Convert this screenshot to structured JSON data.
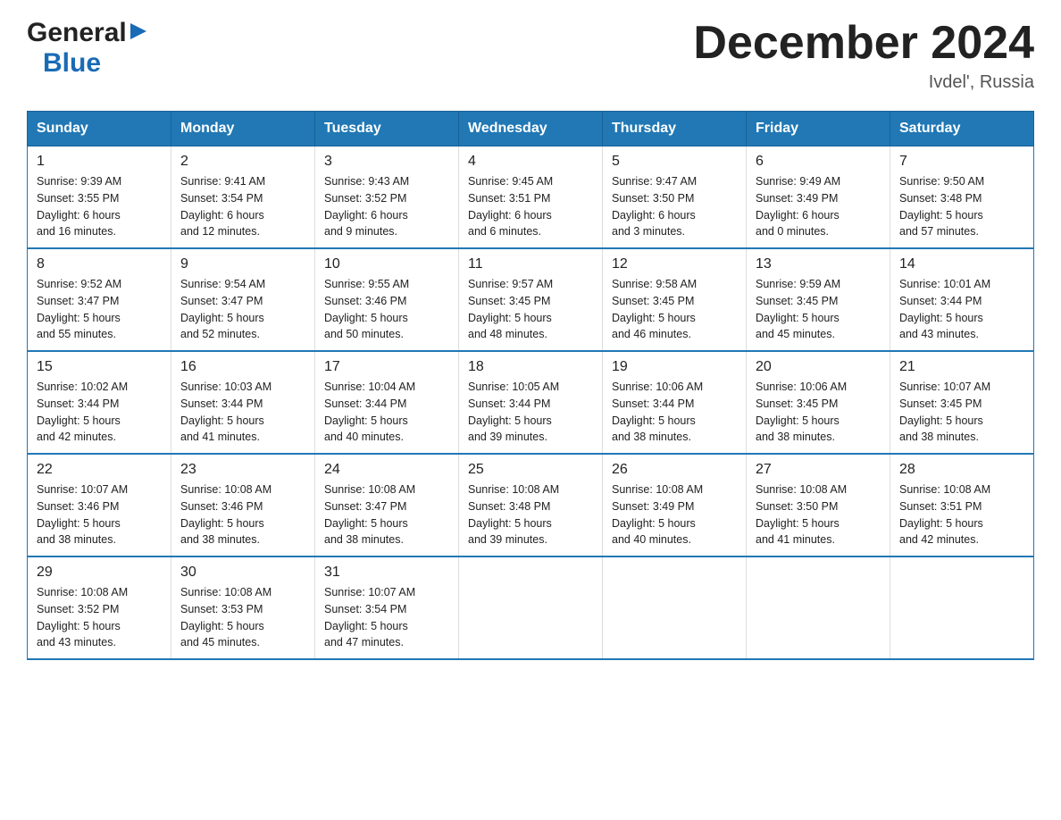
{
  "logo": {
    "general": "General",
    "arrow": "▶",
    "blue": "Blue"
  },
  "title": "December 2024",
  "location": "Ivdel', Russia",
  "headers": [
    "Sunday",
    "Monday",
    "Tuesday",
    "Wednesday",
    "Thursday",
    "Friday",
    "Saturday"
  ],
  "weeks": [
    [
      {
        "day": "1",
        "info": "Sunrise: 9:39 AM\nSunset: 3:55 PM\nDaylight: 6 hours\nand 16 minutes."
      },
      {
        "day": "2",
        "info": "Sunrise: 9:41 AM\nSunset: 3:54 PM\nDaylight: 6 hours\nand 12 minutes."
      },
      {
        "day": "3",
        "info": "Sunrise: 9:43 AM\nSunset: 3:52 PM\nDaylight: 6 hours\nand 9 minutes."
      },
      {
        "day": "4",
        "info": "Sunrise: 9:45 AM\nSunset: 3:51 PM\nDaylight: 6 hours\nand 6 minutes."
      },
      {
        "day": "5",
        "info": "Sunrise: 9:47 AM\nSunset: 3:50 PM\nDaylight: 6 hours\nand 3 minutes."
      },
      {
        "day": "6",
        "info": "Sunrise: 9:49 AM\nSunset: 3:49 PM\nDaylight: 6 hours\nand 0 minutes."
      },
      {
        "day": "7",
        "info": "Sunrise: 9:50 AM\nSunset: 3:48 PM\nDaylight: 5 hours\nand 57 minutes."
      }
    ],
    [
      {
        "day": "8",
        "info": "Sunrise: 9:52 AM\nSunset: 3:47 PM\nDaylight: 5 hours\nand 55 minutes."
      },
      {
        "day": "9",
        "info": "Sunrise: 9:54 AM\nSunset: 3:47 PM\nDaylight: 5 hours\nand 52 minutes."
      },
      {
        "day": "10",
        "info": "Sunrise: 9:55 AM\nSunset: 3:46 PM\nDaylight: 5 hours\nand 50 minutes."
      },
      {
        "day": "11",
        "info": "Sunrise: 9:57 AM\nSunset: 3:45 PM\nDaylight: 5 hours\nand 48 minutes."
      },
      {
        "day": "12",
        "info": "Sunrise: 9:58 AM\nSunset: 3:45 PM\nDaylight: 5 hours\nand 46 minutes."
      },
      {
        "day": "13",
        "info": "Sunrise: 9:59 AM\nSunset: 3:45 PM\nDaylight: 5 hours\nand 45 minutes."
      },
      {
        "day": "14",
        "info": "Sunrise: 10:01 AM\nSunset: 3:44 PM\nDaylight: 5 hours\nand 43 minutes."
      }
    ],
    [
      {
        "day": "15",
        "info": "Sunrise: 10:02 AM\nSunset: 3:44 PM\nDaylight: 5 hours\nand 42 minutes."
      },
      {
        "day": "16",
        "info": "Sunrise: 10:03 AM\nSunset: 3:44 PM\nDaylight: 5 hours\nand 41 minutes."
      },
      {
        "day": "17",
        "info": "Sunrise: 10:04 AM\nSunset: 3:44 PM\nDaylight: 5 hours\nand 40 minutes."
      },
      {
        "day": "18",
        "info": "Sunrise: 10:05 AM\nSunset: 3:44 PM\nDaylight: 5 hours\nand 39 minutes."
      },
      {
        "day": "19",
        "info": "Sunrise: 10:06 AM\nSunset: 3:44 PM\nDaylight: 5 hours\nand 38 minutes."
      },
      {
        "day": "20",
        "info": "Sunrise: 10:06 AM\nSunset: 3:45 PM\nDaylight: 5 hours\nand 38 minutes."
      },
      {
        "day": "21",
        "info": "Sunrise: 10:07 AM\nSunset: 3:45 PM\nDaylight: 5 hours\nand 38 minutes."
      }
    ],
    [
      {
        "day": "22",
        "info": "Sunrise: 10:07 AM\nSunset: 3:46 PM\nDaylight: 5 hours\nand 38 minutes."
      },
      {
        "day": "23",
        "info": "Sunrise: 10:08 AM\nSunset: 3:46 PM\nDaylight: 5 hours\nand 38 minutes."
      },
      {
        "day": "24",
        "info": "Sunrise: 10:08 AM\nSunset: 3:47 PM\nDaylight: 5 hours\nand 38 minutes."
      },
      {
        "day": "25",
        "info": "Sunrise: 10:08 AM\nSunset: 3:48 PM\nDaylight: 5 hours\nand 39 minutes."
      },
      {
        "day": "26",
        "info": "Sunrise: 10:08 AM\nSunset: 3:49 PM\nDaylight: 5 hours\nand 40 minutes."
      },
      {
        "day": "27",
        "info": "Sunrise: 10:08 AM\nSunset: 3:50 PM\nDaylight: 5 hours\nand 41 minutes."
      },
      {
        "day": "28",
        "info": "Sunrise: 10:08 AM\nSunset: 3:51 PM\nDaylight: 5 hours\nand 42 minutes."
      }
    ],
    [
      {
        "day": "29",
        "info": "Sunrise: 10:08 AM\nSunset: 3:52 PM\nDaylight: 5 hours\nand 43 minutes."
      },
      {
        "day": "30",
        "info": "Sunrise: 10:08 AM\nSunset: 3:53 PM\nDaylight: 5 hours\nand 45 minutes."
      },
      {
        "day": "31",
        "info": "Sunrise: 10:07 AM\nSunset: 3:54 PM\nDaylight: 5 hours\nand 47 minutes."
      },
      null,
      null,
      null,
      null
    ]
  ]
}
